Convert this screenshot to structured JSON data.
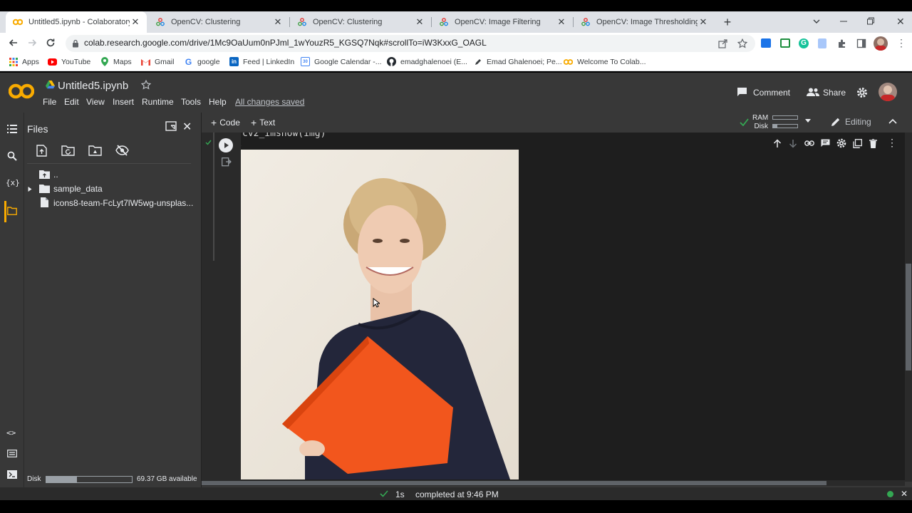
{
  "browser": {
    "tabs": [
      {
        "title": "Untitled5.ipynb - Colaboratory",
        "active": true,
        "favicon": "colab-icon"
      },
      {
        "title": "OpenCV: Clustering",
        "active": false,
        "favicon": "opencv-icon"
      },
      {
        "title": "OpenCV: Clustering",
        "active": false,
        "favicon": "opencv-icon"
      },
      {
        "title": "OpenCV: Image Filtering",
        "active": false,
        "favicon": "opencv-icon"
      },
      {
        "title": "OpenCV: Image Thresholding",
        "active": false,
        "favicon": "opencv-icon"
      }
    ],
    "url": "colab.research.google.com/drive/1Mc9OaUum0nPJml_1wYouzR5_KGSQ7Nqk#scrollTo=iW3KxxG_OAGL",
    "bookmarks": [
      {
        "label": "Apps",
        "icon": "apps-grid-icon"
      },
      {
        "label": "YouTube",
        "icon": "youtube-icon"
      },
      {
        "label": "Maps",
        "icon": "maps-icon"
      },
      {
        "label": "Gmail",
        "icon": "gmail-icon"
      },
      {
        "label": "google",
        "icon": "google-icon"
      },
      {
        "label": "Feed | LinkedIn",
        "icon": "linkedin-icon"
      },
      {
        "label": "Google Calendar -...",
        "icon": "calendar-icon"
      },
      {
        "label": "emadghalenoei (E...",
        "icon": "github-icon"
      },
      {
        "label": "Emad Ghalenoei; Pe...",
        "icon": "pen-icon"
      },
      {
        "label": "Welcome To Colab...",
        "icon": "colab-icon"
      }
    ]
  },
  "colab": {
    "logo": "CO",
    "notebook_title": "Untitled5.ipynb",
    "menu": [
      "File",
      "Edit",
      "View",
      "Insert",
      "Runtime",
      "Tools",
      "Help"
    ],
    "save_status": "All changes saved",
    "comment_label": "Comment",
    "share_label": "Share",
    "add_code_label": "Code",
    "add_text_label": "Text",
    "ram_label": "RAM",
    "disk_label": "Disk",
    "editing_label": "Editing",
    "code_line": "cv2_imshow(img)"
  },
  "files_panel": {
    "title": "Files",
    "items": [
      {
        "label": "..",
        "type": "parent"
      },
      {
        "label": "sample_data",
        "type": "folder"
      },
      {
        "label": "icons8-team-FcLyt7lW5wg-unsplas...",
        "type": "file"
      }
    ],
    "disk_label": "Disk",
    "disk_available": "69.37 GB available",
    "disk_used_fraction": 0.36
  },
  "status": {
    "duration": "1s",
    "completed": "completed at 9:46 PM"
  },
  "colors": {
    "colab_orange": "#f9ab00",
    "status_green": "#34a853",
    "book_orange": "#f2561d"
  }
}
